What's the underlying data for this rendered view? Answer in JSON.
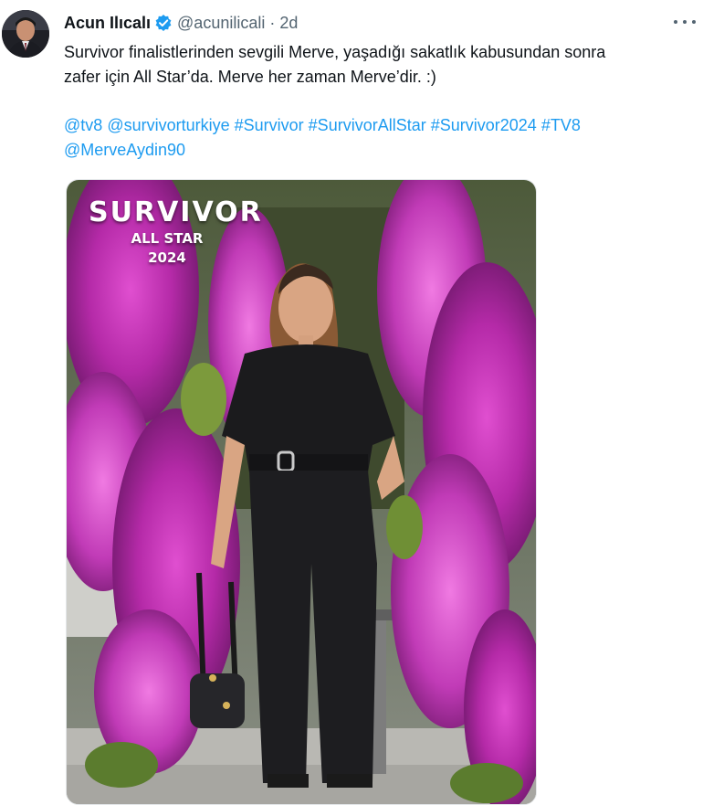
{
  "tweet": {
    "author": {
      "display_name": "Acun Ilıcalı",
      "handle": "@acunilicali",
      "verified": true,
      "avatar_icon": "profile-avatar"
    },
    "separator": "·",
    "time": "2d",
    "more_icon": "more-options-icon",
    "text_lines": [
      "Survivor finalistlerinden sevgili Merve, yaşadığı sakatlık kabusundan sonra",
      "zafer için All Star’da. Merve her zaman Merve’dir. :)"
    ],
    "links_line1": [
      "@tv8",
      "@survivorturkiye",
      "#Survivor",
      "#SurvivorAllStar",
      "#Survivor2024",
      "#TV8"
    ],
    "links_line2": [
      "@MerveAydin90"
    ],
    "media": {
      "overlay_logo": "SURVIVOR",
      "overlay_line1": "ALL STAR",
      "overlay_line2": "2024"
    }
  },
  "colors": {
    "text_primary": "#0f1419",
    "text_secondary": "#536471",
    "link": "#1d9bf0",
    "verified_badge": "#1d9bf0"
  }
}
